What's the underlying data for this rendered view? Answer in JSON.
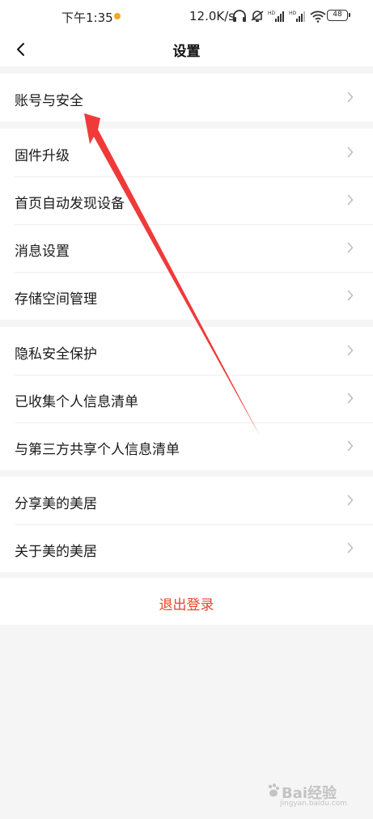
{
  "status_bar": {
    "time": "下午1:35",
    "network_speed": "12.0K/s",
    "battery": "48",
    "icons": [
      "headphones-icon",
      "mute-icon",
      "signal-hd-icon",
      "signal-hd-icon",
      "wifi-icon",
      "battery-icon"
    ],
    "dot_color": "#f5a623"
  },
  "nav": {
    "title": "设置",
    "back_icon": "chevron-left-icon"
  },
  "groups": [
    {
      "items": [
        {
          "label": "账号与安全"
        }
      ]
    },
    {
      "items": [
        {
          "label": "固件升级"
        },
        {
          "label": "首页自动发现设备"
        },
        {
          "label": "消息设置"
        },
        {
          "label": "存储空间管理"
        }
      ]
    },
    {
      "items": [
        {
          "label": "隐私安全保护"
        },
        {
          "label": "已收集个人信息清单"
        },
        {
          "label": "与第三方共享个人信息清单"
        }
      ]
    },
    {
      "items": [
        {
          "label": "分享美的美居"
        },
        {
          "label": "关于美的美居"
        }
      ]
    }
  ],
  "logout": {
    "label": "退出登录",
    "color": "#e8452b"
  },
  "annotation": {
    "arrow_color": "#f03a3a"
  },
  "watermark": {
    "text": "Bai经验",
    "sub": "jingyan.baidu.com"
  }
}
